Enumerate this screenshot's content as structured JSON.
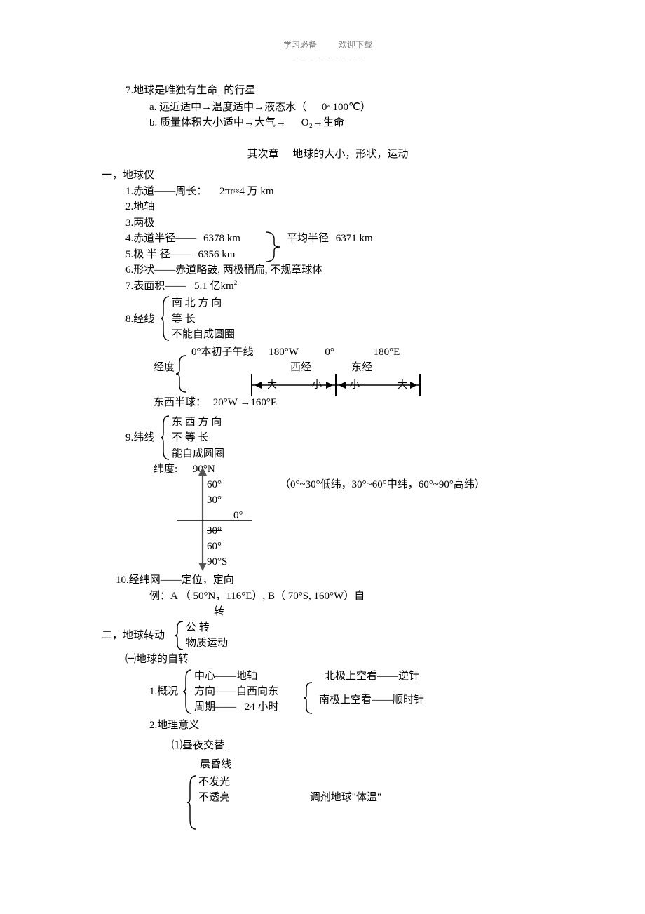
{
  "header": {
    "left": "学习必备",
    "right": "欢迎下载"
  },
  "s7": {
    "title": "7.地球是唯独有生命",
    "title2": "的行星",
    "a": "a.  远近适中→温度适中→液态水（",
    "a_range": "0~100℃）",
    "b": "b.  质量体积大小适中→大气→",
    "b_o2": "O₂→生命"
  },
  "chapter2": {
    "left": "其次章",
    "right": "地球的大小，形状，运动"
  },
  "h1": "一，地球仪",
  "g": {
    "l1": "1.赤道——周长：",
    "l1v": "2πr≈4 万 km",
    "l2": "2.地轴",
    "l3": "3.两极",
    "l4": "4.赤道半径——",
    "l4v": "6378 km",
    "l5": "5.极  半  径——",
    "l5v": "6356 km",
    "avg_lbl": "平均半径",
    "avg_v": "6371 km",
    "l6": "6.形状——赤道略鼓, 两极稍扁, 不规章球体",
    "l7": "7.表面积——",
    "l7v": "5.1 亿km",
    "sq": "2"
  },
  "meridian": {
    "lbl": "8.经线",
    "a": "南   北  方  向",
    "b": "等        长",
    "c": "不能自成圆圈",
    "deg_lbl": "经度",
    "line0": "0°本初子午线",
    "w180": "180°W",
    "zero": "0°",
    "e180": "180°E",
    "xij": "西经",
    "dj": "东经",
    "da": "大",
    "xiao": "小",
    "hemi": "东西半球：",
    "hemi_v": "20°W →160°E"
  },
  "parallel": {
    "lbl": "9.纬线",
    "a": "东   西  方  向",
    "b": "不    等    长",
    "c": "能自成圆圈",
    "lat_lbl": "纬度:",
    "n90": "90°N",
    "p60": "60°",
    "p30": "30°",
    "p0": "0°",
    "s90": "90°S",
    "band": "（0°~30°低纬，30°~60°中纬，60°~90°高纬）"
  },
  "l10": {
    "t": "10.经纬网——定位，定向",
    "ex": "例：A （ 50°N，116°E）, B（ 70°S, 160°W）自",
    "zhuan": "转"
  },
  "h2": "二，地球转动",
  "rot": {
    "a": "公        转",
    "b": "物质运动",
    "sub": "㈠地球的自转",
    "ovw_lbl": "1.概况",
    "center": "中心——地轴",
    "dir": "方向——自西向东",
    "period_l": "周期——",
    "period_v": "24 小时",
    "north": "北极上空看——逆针",
    "south": "南极上空看——顺时针",
    "geo": "2.地理意义",
    "alt": "⑴昼夜交替",
    "term": "晨昏线",
    "nf": "不发光",
    "nt": "不透亮",
    "temp": "调剂地球\"体温\""
  }
}
